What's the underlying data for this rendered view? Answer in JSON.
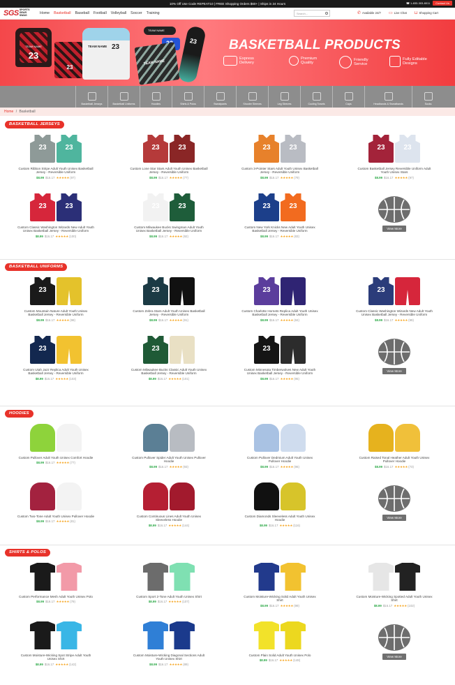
{
  "topbar": {
    "promo": "10% Off Use Code REPEAT10 | FREE Shopping Orders $60+ | Ships in 24 Hours",
    "phone": "1-833-303-8011",
    "contact_label": "Contact Us"
  },
  "nav": {
    "logo_mark": "SGS",
    "logo_sub": "SPORTS GEAR SWAG",
    "items": [
      "Home",
      "Basketball",
      "Baseball",
      "Football",
      "Volleyball",
      "Soccer",
      "Training"
    ],
    "active_item": "Basketball",
    "search_placeholder": "Search...",
    "available": "Available 24/7",
    "live_chat": "Live Chat",
    "cart": "Shopping Cart"
  },
  "banner": {
    "title": "BASKETBALL PRODUCTS",
    "features": [
      "Express Delivery",
      "Premium Quality",
      "Friendly Service",
      "Fully Editable Designs"
    ],
    "sample_team": "TEAM NAME",
    "sample_number": "23"
  },
  "categories": [
    "Basketball Jerseys",
    "Basketball Uniforms",
    "Hoodies",
    "Shirts & Polos",
    "Sweatpants",
    "Shooter Sleeves",
    "Leg Sleeves",
    "Cooling Towels",
    "Caps",
    "Headbands & Sweatbands",
    "Socks"
  ],
  "breadcrumb": {
    "home": "Home",
    "sep": "/",
    "current": "Basketball"
  },
  "price_line": {
    "price": "$8.99",
    "mrp": "$16.17",
    "stars": "★★★★★",
    "count": "(97)"
  },
  "view_more": "View More",
  "colors": {
    "accent": "#e8322a",
    "price": "#2aa845",
    "banner": "#f4474a"
  },
  "sections": [
    {
      "title": "BASKETBALL JERSEYS",
      "products": [
        {
          "title": "Custom Ribbon Stripe Adult Youth Unisex Basketball Jersey - Reversible Uniform",
          "price": "$8.99",
          "count": "(97)",
          "c1": "#8e9a98",
          "c2": "#4fb59e"
        },
        {
          "title": "Custom Lone Star Stars Adult Youth Unisex Basketball Jersey - Reversible Uniform",
          "price": "$8.99",
          "count": "(77)",
          "c1": "#b53a3a",
          "c2": "#8a2626"
        },
        {
          "title": "Custom 3-Pointer Stars Adult Youth Unisex Basketball Jersey - Reversible Uniform",
          "price": "$8.99",
          "count": "(79)",
          "c1": "#e7812b",
          "c2": "#b9bcc3"
        },
        {
          "title": "Custom Basketball Jersey Reversible Uniform Adult Youth Unisex Stars",
          "price": "$8.99",
          "count": "(97)",
          "c1": "#a3233a",
          "c2": "#dde4ee"
        },
        {
          "title": "Custom Classic Washington Wizards New Adult Youth Unisex Basketball Jersey - Reversible Uniform",
          "price": "$8.99",
          "count": "(100)",
          "c1": "#d6263b",
          "c2": "#2b2f77"
        },
        {
          "title": "Custom Milwaukee Bucks Swingman Adult Youth Unisex Basketball Jersey - Reversible Uniform",
          "price": "$8.99",
          "count": "(92)",
          "c1": "#f2f2f2",
          "c2": "#1e5d3a"
        },
        {
          "title": "Custom New York Knicks New Adult Youth Unisex Basketball Jersey - Reversible Uniform",
          "price": "$8.99",
          "count": "(83)",
          "c1": "#1c3f8a",
          "c2": "#f26b1f"
        }
      ]
    },
    {
      "title": "BASKETBALL UNIFORMS",
      "products": [
        {
          "title": "Custom Mountain Nature Adult Youth Unisex Basketball Jersey - Reversible Uniform",
          "price": "$8.99",
          "count": "(98)",
          "c1": "#1a1a1a",
          "c2": "#e4c22b"
        },
        {
          "title": "Custom Zebra Stars Adult Youth Unisex Basketball Jersey - Reversible Uniform",
          "price": "$8.99",
          "count": "(91)",
          "c1": "#1b3a44",
          "c2": "#111111"
        },
        {
          "title": "Custom Charlotte Hornets Replica Adult Youth Unisex Basketball Jersey - Reversible Uniform",
          "price": "$8.99",
          "count": "(84)",
          "c1": "#5b3d9c",
          "c2": "#2f2473"
        },
        {
          "title": "Custom Classic Washington Wizards New Adult Youth Unisex Basketball Jersey - Reversible Uniform",
          "price": "$8.99",
          "count": "(99)",
          "c1": "#2b3c7a",
          "c2": "#d6263b"
        },
        {
          "title": "Custom Utah Jazz Replica Adult Youth Unisex Basketball Jersey - Reversible Uniform",
          "price": "$8.99",
          "count": "(103)",
          "c1": "#13284f",
          "c2": "#f2c230"
        },
        {
          "title": "Custom Milwaukee Bucks Classic Adult Youth Unisex Basketball Jersey - Reversible Uniform",
          "price": "$8.99",
          "count": "(101)",
          "c1": "#1f5a36",
          "c2": "#e9e0c4"
        },
        {
          "title": "Custom Minnesota Timberwolves New Adult Youth Unisex Basketball Jersey - Reversible Uniform",
          "price": "$8.99",
          "count": "(95)",
          "c1": "#151515",
          "c2": "#2c2c2c"
        }
      ]
    },
    {
      "title": "HOODIES",
      "products": [
        {
          "title": "Custom Pullover Adult Youth Unisex Comfort Hoodie",
          "price": "$8.99",
          "count": "(77)",
          "c1": "#8ed33b",
          "c2": "#f3f3f3"
        },
        {
          "title": "Custom Pullover Spider Adult Youth Unisex Pullover Hoodie",
          "price": "$8.99",
          "count": "(93)",
          "c1": "#5b7f95",
          "c2": "#b8bcc2"
        },
        {
          "title": "Custom Pullover Dedmium Adult Youth Unisex Pullover Hoodie",
          "price": "$8.99",
          "count": "(96)",
          "c1": "#a9c2e3",
          "c2": "#cfdcee"
        },
        {
          "title": "Custom Raised Tonal Heather Adult Youth Unisex Pullover Hoodie",
          "price": "$8.99",
          "count": "(73)",
          "c1": "#e6b21e",
          "c2": "#f0c03a"
        },
        {
          "title": "Custom Two-Tone Adult Youth Unisex Pullover Hoodie",
          "price": "$8.99",
          "count": "(81)",
          "c1": "#a3223f",
          "c2": "#f3f3f3"
        },
        {
          "title": "Custom Continuous Lines Adult Youth Unisex Sleeveless Hoodie",
          "price": "$8.99",
          "count": "(144)",
          "c1": "#b51f33",
          "c2": "#a21a2d"
        },
        {
          "title": "Custom Diamonds Sleeveless Adult Youth Unisex Hoodie",
          "price": "$8.99",
          "count": "(116)",
          "c1": "#111111",
          "c2": "#d7c42a"
        }
      ]
    },
    {
      "title": "SHIRTS & POLOS",
      "products": [
        {
          "title": "Custom Performance Mesh Adult Youth Unisex Polo",
          "price": "$8.99",
          "count": "(79)",
          "c1": "#1a1a1a",
          "c2": "#f29aa8"
        },
        {
          "title": "Custom Sport 2-Tone Adult Youth Unisex Shirt",
          "price": "$8.99",
          "count": "(107)",
          "c1": "#6c6c6c",
          "c2": "#7fe0b2"
        },
        {
          "title": "Custom Moisture-Wicking Solid Adult Youth Unisex Shirt",
          "price": "$8.99",
          "count": "(99)",
          "c1": "#223a8c",
          "c2": "#f2c230"
        },
        {
          "title": "Custom Moisture-Wicking Spotted Adult Youth Unisex Shirt",
          "price": "$8.99",
          "count": "(102)",
          "c1": "#e6e6e6",
          "c2": "#222222"
        },
        {
          "title": "Custom Moisture-Wicking Spot Stripe Adult Youth Unisex Shirt",
          "price": "$8.99",
          "count": "(142)",
          "c1": "#1a1a1a",
          "c2": "#39b6e6"
        },
        {
          "title": "Custom Moisture-Wicking Diagonal Sections Adult Youth Unisex Shirt",
          "price": "$8.99",
          "count": "(89)",
          "c1": "#2f7fd6",
          "c2": "#1b3a8c"
        },
        {
          "title": "Custom Plain Solid Adult Youth Unisex Polo",
          "price": "$8.99",
          "count": "(148)",
          "c1": "#f2e22a",
          "c2": "#ecd81f"
        }
      ]
    }
  ]
}
